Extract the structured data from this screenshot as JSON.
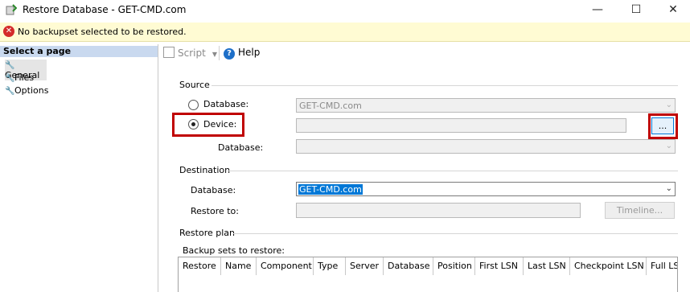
{
  "window": {
    "title": "Restore Database - GET-CMD.com",
    "minimize": "—",
    "maximize": "☐",
    "close": "✕"
  },
  "error": {
    "message": "No backupset selected to be restored."
  },
  "left": {
    "header": "Select a page",
    "items": [
      {
        "label": "General"
      },
      {
        "label": "Files"
      },
      {
        "label": "Options"
      }
    ]
  },
  "toolbar": {
    "script_label": "Script",
    "help_label": "Help"
  },
  "source": {
    "group_label": "Source",
    "database_radio_label": "Database:",
    "database_value": "GET-CMD.com",
    "device_radio_label": "Device:",
    "device_value": "",
    "browse_label": "...",
    "device_database_label": "Database:"
  },
  "destination": {
    "group_label": "Destination",
    "database_label": "Database:",
    "database_value": "GET-CMD.com",
    "restore_to_label": "Restore to:",
    "timeline_label": "Timeline..."
  },
  "restore_plan": {
    "group_label": "Restore plan",
    "backup_sets_label": "Backup sets to restore:",
    "columns": [
      "Restore",
      "Name",
      "Component",
      "Type",
      "Server",
      "Database",
      "Position",
      "First LSN",
      "Last LSN",
      "Checkpoint LSN",
      "Full LS"
    ]
  },
  "colors": {
    "highlight_red": "#c00000",
    "error_bg": "#fffbd3",
    "selection_blue": "#0078d7"
  }
}
